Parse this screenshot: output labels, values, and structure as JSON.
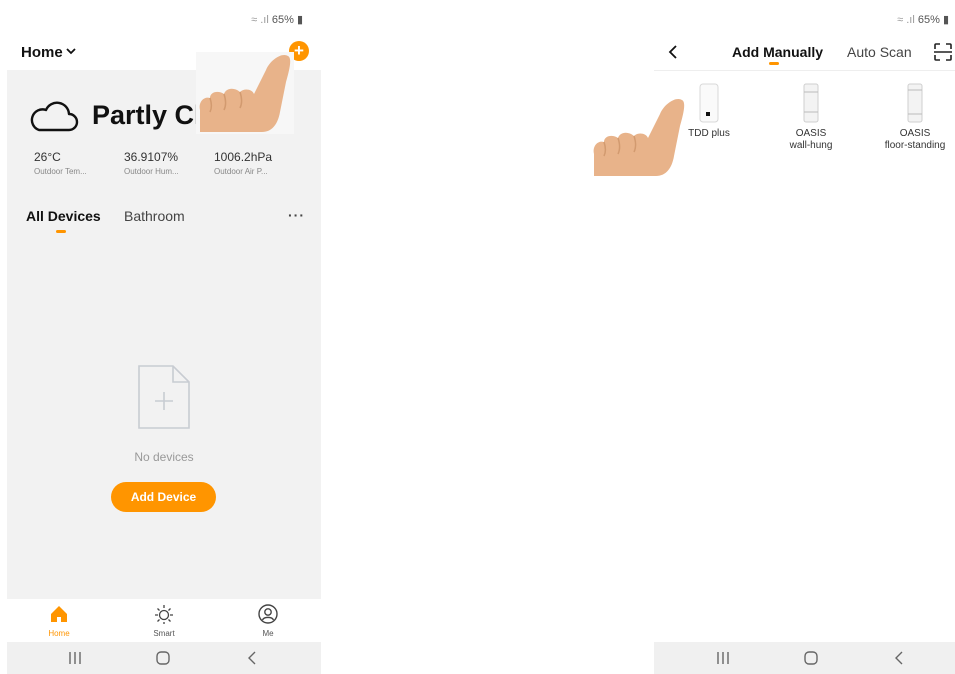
{
  "left_screen": {
    "status": {
      "battery": "65%"
    },
    "header": {
      "home_label": "Home"
    },
    "weather": {
      "condition": "Partly Cl",
      "stats": [
        {
          "value": "26°C",
          "label": "Outdoor Tem..."
        },
        {
          "value": "36.9107%",
          "label": "Outdoor Hum..."
        },
        {
          "value": "1006.2hPa",
          "label": "Outdoor Air P..."
        }
      ]
    },
    "tabs": [
      {
        "label": "All Devices",
        "active": true
      },
      {
        "label": "Bathroom",
        "active": false
      }
    ],
    "more_label": "···",
    "empty_state": {
      "text": "No devices",
      "button": "Add Device"
    },
    "bottom_nav": [
      {
        "label": "Home",
        "icon": "home-icon",
        "active": true
      },
      {
        "label": "Smart",
        "icon": "sun-icon",
        "active": false
      },
      {
        "label": "Me",
        "icon": "profile-icon",
        "active": false
      }
    ]
  },
  "right_screen": {
    "status": {
      "battery": "65%"
    },
    "tabs": [
      {
        "label": "Add Manually",
        "active": true
      },
      {
        "label": "Auto Scan",
        "active": false
      }
    ],
    "devices": [
      {
        "line1": "TDD plus",
        "line2": ""
      },
      {
        "line1": "OASIS",
        "line2": "wall-hung"
      },
      {
        "line1": "OASIS",
        "line2": "floor-standing"
      }
    ]
  },
  "colors": {
    "accent": "#ff9500",
    "background": "#f2f2f2"
  }
}
